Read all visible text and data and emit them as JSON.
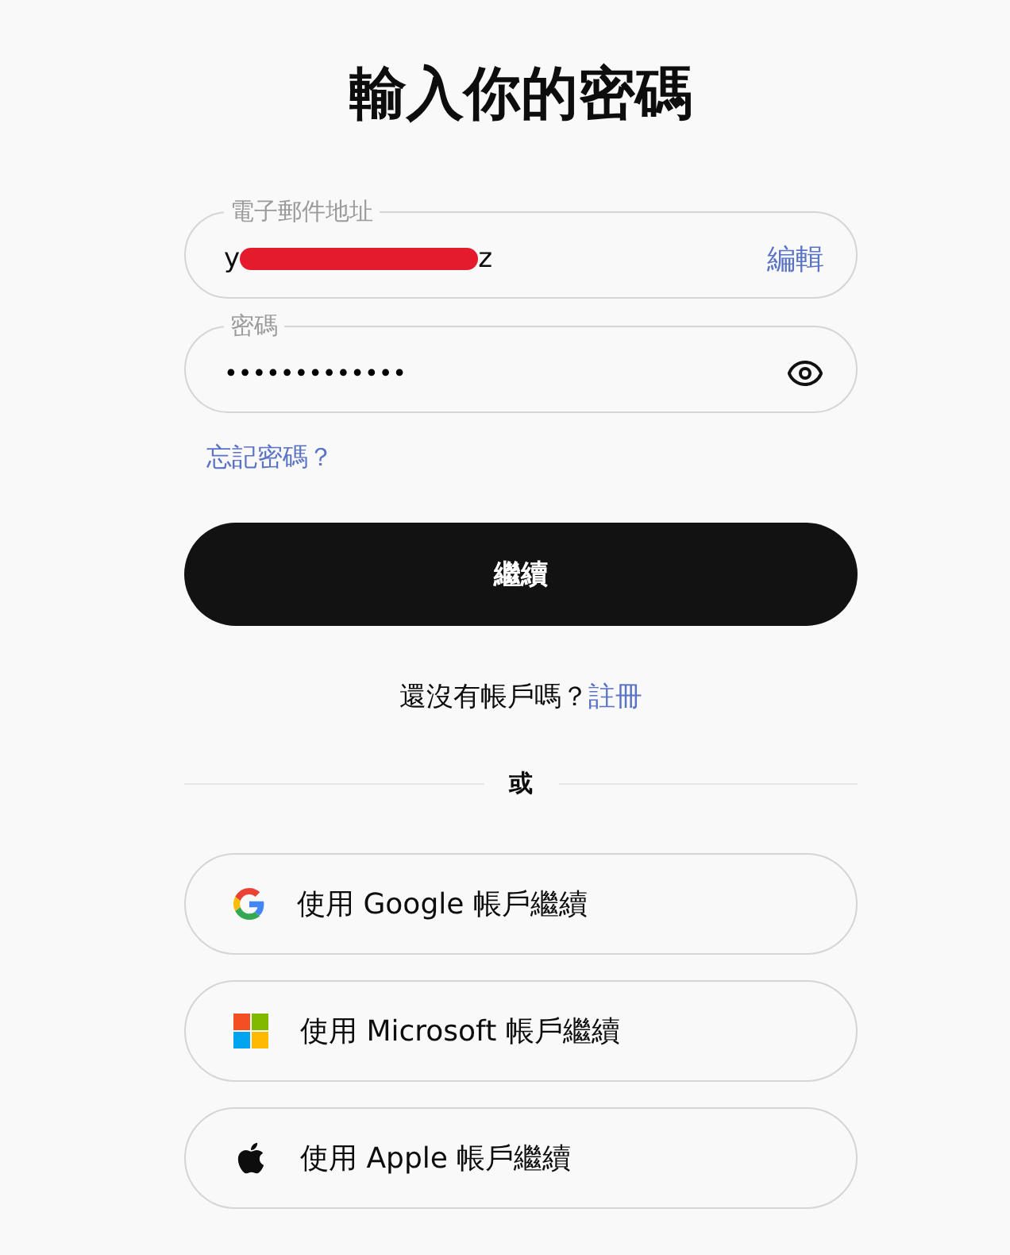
{
  "title": "輸入你的密碼",
  "email": {
    "label": "電子郵件地址",
    "value_start": "y",
    "redacted": true,
    "value_end": "z",
    "edit": "編輯"
  },
  "password": {
    "label": "密碼",
    "value": "•••••••••••••"
  },
  "forgot_link": "忘記密碼？",
  "continue_button": "繼續",
  "signup": {
    "text": "還沒有帳戶嗎？",
    "link": "註冊"
  },
  "divider": "或",
  "social_buttons": [
    {
      "kind": "google",
      "label": "使用 Google 帳戶繼續"
    },
    {
      "kind": "microsoft",
      "label": "使用 Microsoft 帳戶繼續"
    },
    {
      "kind": "apple",
      "label": "使用 Apple 帳戶繼續"
    }
  ]
}
